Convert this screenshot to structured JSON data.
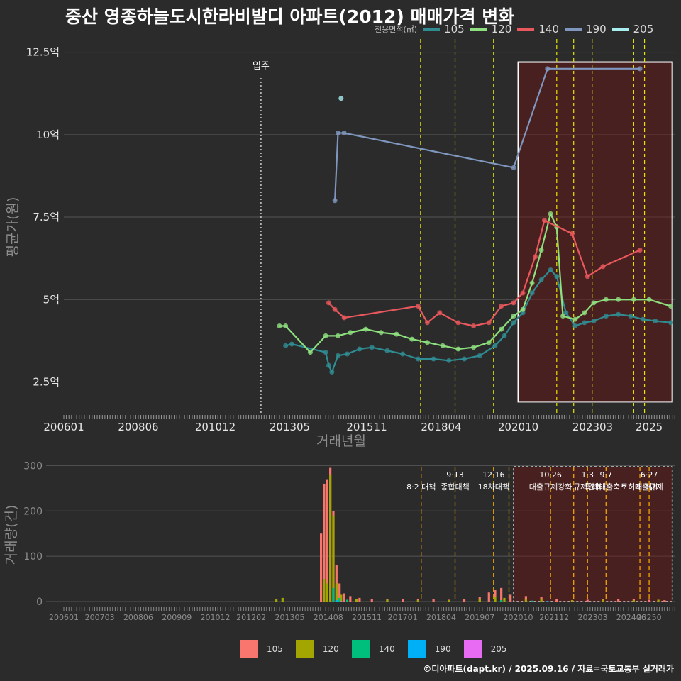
{
  "title": "중산 영종하늘도시한라비발디 아파트(2012) 매매가격 변화",
  "credit": "©디아파트(dapt.kr) / 2025.09.16 / 자료=국토교통부 실거래가",
  "legend_top": {
    "title": "전용면적(㎡)",
    "items": [
      {
        "label": "105",
        "color": "#2f8c92"
      },
      {
        "label": "120",
        "color": "#8ee07f"
      },
      {
        "label": "140",
        "color": "#e8585c"
      },
      {
        "label": "190",
        "color": "#7f97be"
      },
      {
        "label": "205",
        "color": "#a8eef0"
      }
    ]
  },
  "legend_bottom": {
    "items": [
      {
        "label": "105",
        "color": "#f8766d"
      },
      {
        "label": "120",
        "color": "#a3a500"
      },
      {
        "label": "140",
        "color": "#00bf7d"
      },
      {
        "label": "190",
        "color": "#00b0f6"
      },
      {
        "label": "205",
        "color": "#e76bf3"
      }
    ]
  },
  "chart_data": [
    {
      "type": "line",
      "ylabel": "평균가(원)",
      "xlabel": "거래년월",
      "x_tick_labels": [
        "200601",
        "200806",
        "201012",
        "201305",
        "201511",
        "201804",
        "202010",
        "202303",
        "2025"
      ],
      "y_ticks": [
        {
          "v": 2.5,
          "label": "2.5억"
        },
        {
          "v": 5,
          "label": "5억"
        },
        {
          "v": 7.5,
          "label": "7.5억"
        },
        {
          "v": 10,
          "label": "10억"
        },
        {
          "v": 12.5,
          "label": "12.5억"
        }
      ],
      "annotation": {
        "label": "입주",
        "x": 2012.4
      },
      "policy_lines": [
        2017.58,
        2018.7,
        2019.95,
        2022.0,
        2022.55,
        2023.15,
        2024.5,
        2024.85
      ],
      "highlight": {
        "x0": 2020.75,
        "x1": 2025.75,
        "y0": 1.9,
        "y1": 12.2
      },
      "series": [
        {
          "name": "105",
          "points": [
            [
              2013.2,
              3.6
            ],
            [
              2013.4,
              3.65
            ],
            [
              2014.5,
              3.4
            ],
            [
              2014.6,
              3.0
            ],
            [
              2014.7,
              2.8
            ],
            [
              2014.9,
              3.3
            ],
            [
              2015.2,
              3.35
            ],
            [
              2015.6,
              3.5
            ],
            [
              2016.0,
              3.55
            ],
            [
              2016.5,
              3.45
            ],
            [
              2017.0,
              3.35
            ],
            [
              2017.5,
              3.2
            ],
            [
              2018.0,
              3.2
            ],
            [
              2018.5,
              3.15
            ],
            [
              2019.0,
              3.2
            ],
            [
              2019.5,
              3.3
            ],
            [
              2020.0,
              3.6
            ],
            [
              2020.3,
              3.9
            ],
            [
              2020.6,
              4.3
            ],
            [
              2020.9,
              4.6
            ],
            [
              2021.2,
              5.2
            ],
            [
              2021.5,
              5.6
            ],
            [
              2021.8,
              5.9
            ],
            [
              2022.0,
              5.7
            ],
            [
              2022.3,
              4.6
            ],
            [
              2022.6,
              4.2
            ],
            [
              2022.9,
              4.3
            ],
            [
              2023.2,
              4.35
            ],
            [
              2023.6,
              4.5
            ],
            [
              2024.0,
              4.55
            ],
            [
              2024.4,
              4.5
            ],
            [
              2024.8,
              4.4
            ],
            [
              2025.2,
              4.35
            ],
            [
              2025.7,
              4.3
            ]
          ]
        },
        {
          "name": "120",
          "points": [
            [
              2013.0,
              4.2
            ],
            [
              2013.2,
              4.2
            ],
            [
              2014.0,
              3.4
            ],
            [
              2014.5,
              3.9
            ],
            [
              2014.9,
              3.9
            ],
            [
              2015.3,
              4.0
            ],
            [
              2015.8,
              4.1
            ],
            [
              2016.3,
              4.0
            ],
            [
              2016.8,
              3.95
            ],
            [
              2017.3,
              3.8
            ],
            [
              2017.8,
              3.7
            ],
            [
              2018.3,
              3.6
            ],
            [
              2018.8,
              3.5
            ],
            [
              2019.3,
              3.55
            ],
            [
              2019.8,
              3.7
            ],
            [
              2020.2,
              4.1
            ],
            [
              2020.6,
              4.5
            ],
            [
              2020.9,
              4.7
            ],
            [
              2021.2,
              5.5
            ],
            [
              2021.5,
              6.5
            ],
            [
              2021.8,
              7.6
            ],
            [
              2022.0,
              7.2
            ],
            [
              2022.2,
              4.5
            ],
            [
              2022.6,
              4.4
            ],
            [
              2022.9,
              4.6
            ],
            [
              2023.2,
              4.9
            ],
            [
              2023.6,
              5.0
            ],
            [
              2024.0,
              5.0
            ],
            [
              2024.5,
              5.0
            ],
            [
              2025.0,
              5.0
            ],
            [
              2025.7,
              4.8
            ]
          ]
        },
        {
          "name": "140",
          "points": [
            [
              2014.6,
              4.9
            ],
            [
              2014.8,
              4.7
            ],
            [
              2015.1,
              4.45
            ],
            [
              2017.5,
              4.8
            ],
            [
              2017.8,
              4.3
            ],
            [
              2018.2,
              4.6
            ],
            [
              2018.8,
              4.3
            ],
            [
              2019.3,
              4.2
            ],
            [
              2019.8,
              4.3
            ],
            [
              2020.2,
              4.8
            ],
            [
              2020.6,
              4.9
            ],
            [
              2020.9,
              5.2
            ],
            [
              2021.3,
              6.3
            ],
            [
              2021.6,
              7.4
            ],
            [
              2022.5,
              7.0
            ],
            [
              2023.0,
              5.7
            ],
            [
              2023.5,
              6.0
            ],
            [
              2024.7,
              6.5
            ]
          ]
        },
        {
          "name": "190",
          "points": [
            [
              2014.8,
              8.0
            ],
            [
              2014.9,
              10.05
            ],
            [
              2015.1,
              10.05
            ],
            [
              2020.6,
              9.0
            ],
            [
              2021.7,
              12.0
            ],
            [
              2024.7,
              12.0
            ]
          ]
        },
        {
          "name": "205",
          "points": [
            [
              2015.0,
              11.1
            ]
          ]
        }
      ]
    },
    {
      "type": "bar",
      "ylabel": "거래량(건)",
      "y_ticks": [
        0,
        100,
        200,
        300
      ],
      "x_tick_labels": [
        "200601",
        "200703",
        "200806",
        "200909",
        "201012",
        "201202",
        "201305",
        "201408",
        "201511",
        "201701",
        "201804",
        "201907",
        "202010",
        "202112",
        "202303",
        "202406",
        "20250"
      ],
      "highlight": {
        "x0": 2020.6,
        "x1": 2025.75
      },
      "policies": [
        {
          "x": 2017.6,
          "date": "",
          "name": "8·2 대책"
        },
        {
          "x": 2018.7,
          "date": "9·13",
          "name": "종합대책"
        },
        {
          "x": 2019.95,
          "date": "12·16",
          "name": "18차대책"
        },
        {
          "x": 2020.45,
          "date": "",
          "name": ""
        },
        {
          "x": 2021.8,
          "date": "10·26",
          "name": "대출규제강화"
        },
        {
          "x": 2022.55,
          "date": "",
          "name": ""
        },
        {
          "x": 2023.0,
          "date": "1·3",
          "name": "규제완화"
        },
        {
          "x": 2023.6,
          "date": "9·7",
          "name": "특례대출축소"
        },
        {
          "x": 2024.7,
          "date": "",
          "name": "토허제 해제"
        },
        {
          "x": 2025.0,
          "date": "6·27",
          "name": "대출규제"
        }
      ],
      "series": [
        {
          "name": "105",
          "bars": [
            [
              2014.35,
              150
            ],
            [
              2014.45,
              260
            ],
            [
              2014.55,
              270
            ],
            [
              2014.65,
              295
            ],
            [
              2014.75,
              200
            ],
            [
              2014.85,
              80
            ],
            [
              2014.95,
              40
            ],
            [
              2015.1,
              18
            ],
            [
              2015.3,
              12
            ],
            [
              2015.6,
              8
            ],
            [
              2016.0,
              6
            ],
            [
              2016.5,
              5
            ],
            [
              2017.0,
              5
            ],
            [
              2017.5,
              6
            ],
            [
              2018.0,
              5
            ],
            [
              2018.5,
              4
            ],
            [
              2019.0,
              6
            ],
            [
              2019.5,
              10
            ],
            [
              2019.8,
              20
            ],
            [
              2020.0,
              25
            ],
            [
              2020.2,
              30
            ],
            [
              2020.5,
              15
            ],
            [
              2021.0,
              12
            ],
            [
              2021.5,
              10
            ],
            [
              2022.0,
              5
            ],
            [
              2022.5,
              3
            ],
            [
              2023.0,
              4
            ],
            [
              2023.5,
              5
            ],
            [
              2024.0,
              6
            ],
            [
              2024.5,
              5
            ],
            [
              2025.0,
              4
            ],
            [
              2025.5,
              3
            ]
          ]
        },
        {
          "name": "120",
          "bars": [
            [
              2012.9,
              5
            ],
            [
              2013.1,
              8
            ],
            [
              2014.45,
              50
            ],
            [
              2014.55,
              40
            ],
            [
              2014.65,
              280
            ],
            [
              2014.75,
              190
            ],
            [
              2014.85,
              40
            ],
            [
              2015.0,
              15
            ],
            [
              2015.5,
              6
            ],
            [
              2016.5,
              4
            ],
            [
              2017.5,
              3
            ],
            [
              2018.5,
              3
            ],
            [
              2019.5,
              5
            ],
            [
              2020.0,
              10
            ],
            [
              2020.3,
              8
            ],
            [
              2021.0,
              6
            ],
            [
              2021.5,
              5
            ],
            [
              2022.5,
              3
            ],
            [
              2023.5,
              4
            ],
            [
              2024.5,
              3
            ],
            [
              2025.3,
              4
            ]
          ]
        },
        {
          "name": "140",
          "bars": [
            [
              2014.75,
              30
            ],
            [
              2014.95,
              8
            ],
            [
              2015.2,
              4
            ],
            [
              2020.2,
              3
            ],
            [
              2021.2,
              2
            ]
          ]
        },
        {
          "name": "190",
          "bars": [
            [
              2014.85,
              3
            ],
            [
              2021.7,
              1
            ]
          ]
        },
        {
          "name": "205",
          "bars": [
            [
              2015.0,
              1
            ]
          ]
        }
      ]
    }
  ]
}
